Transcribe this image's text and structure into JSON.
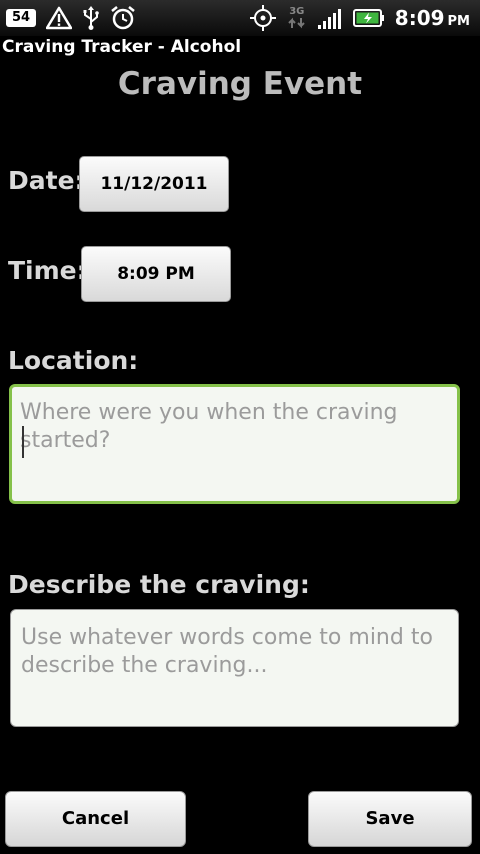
{
  "status_bar": {
    "notification_count": "54",
    "icons": [
      "warning-icon",
      "usb-icon",
      "alarm-icon",
      "gps-icon",
      "3g-data-icon",
      "signal-icon",
      "battery-charging-icon"
    ],
    "network_type": "3G",
    "time": "8:09",
    "ampm": "PM"
  },
  "app": {
    "title": "Craving Tracker - Alcohol"
  },
  "form": {
    "heading": "Craving Event",
    "date_label": "Date:",
    "date_value": "11/12/2011",
    "time_label": "Time:",
    "time_value": "8:09 PM",
    "location_label": "Location:",
    "location_placeholder": "Where were you when the craving started?",
    "describe_label": "Describe the craving:",
    "describe_placeholder": "Use whatever words come to mind to describe the craving..."
  },
  "actions": {
    "cancel_label": "Cancel",
    "save_label": "Save"
  },
  "colors": {
    "background": "#000000",
    "focus_border": "#85c14a",
    "heading": "#bcbcbc"
  }
}
